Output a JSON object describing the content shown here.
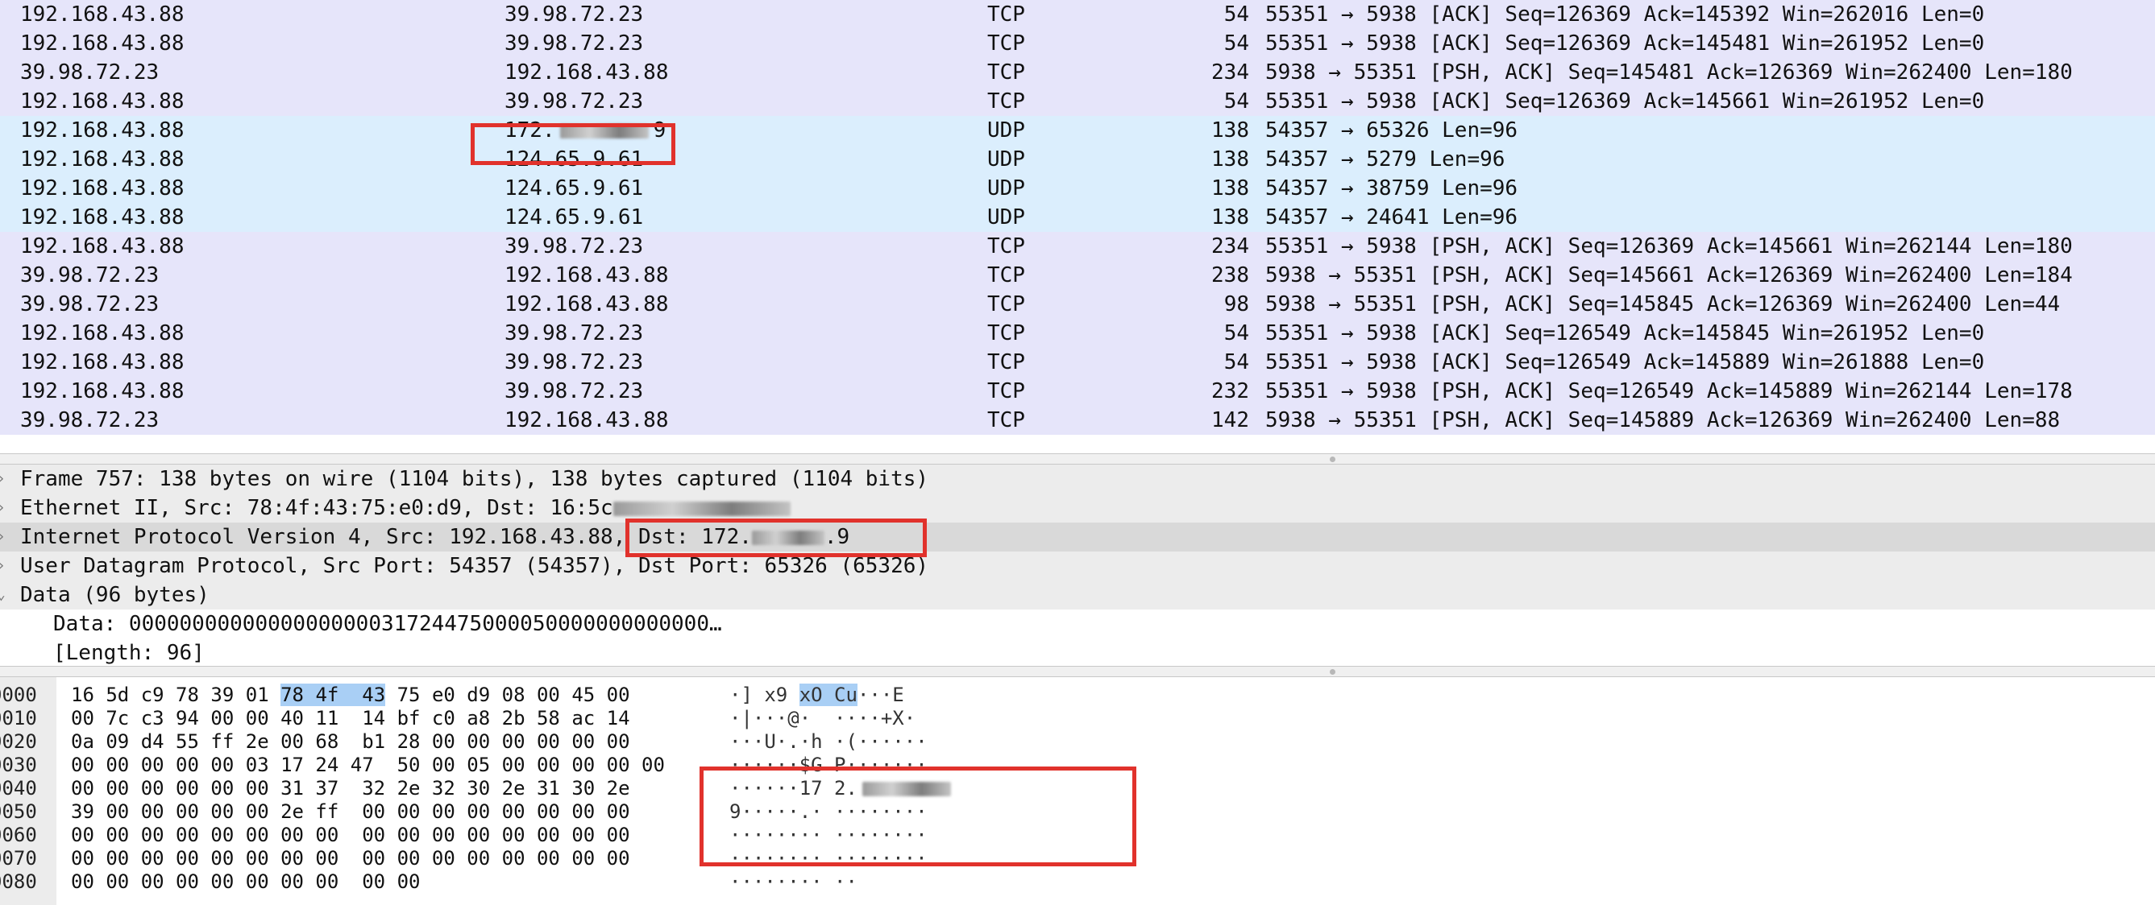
{
  "packets": [
    {
      "src": "192.168.43.88",
      "dst": "39.98.72.23",
      "proto": "TCP",
      "len": "54",
      "info": "55351 → 5938 [ACK] Seq=126369 Ack=145392 Win=262016 Len=0",
      "kind": "tcp"
    },
    {
      "src": "192.168.43.88",
      "dst": "39.98.72.23",
      "proto": "TCP",
      "len": "54",
      "info": "55351 → 5938 [ACK] Seq=126369 Ack=145481 Win=261952 Len=0",
      "kind": "tcp"
    },
    {
      "src": "39.98.72.23",
      "dst": "192.168.43.88",
      "proto": "TCP",
      "len": "234",
      "info": "5938 → 55351 [PSH, ACK] Seq=145481 Ack=126369 Win=262400 Len=180",
      "kind": "tcp"
    },
    {
      "src": "192.168.43.88",
      "dst": "39.98.72.23",
      "proto": "TCP",
      "len": "54",
      "info": "55351 → 5938 [ACK] Seq=126369 Ack=145661 Win=261952 Len=0",
      "kind": "tcp"
    },
    {
      "src": "192.168.43.88",
      "dst": "172.",
      "dst_tail": "9",
      "proto": "UDP",
      "len": "138",
      "info": "54357 → 65326 Len=96",
      "kind": "udp"
    },
    {
      "src": "192.168.43.88",
      "dst": "124.65.9.61",
      "proto": "UDP",
      "len": "138",
      "info": "54357 → 5279 Len=96",
      "kind": "udp"
    },
    {
      "src": "192.168.43.88",
      "dst": "124.65.9.61",
      "proto": "UDP",
      "len": "138",
      "info": "54357 → 38759 Len=96",
      "kind": "udp"
    },
    {
      "src": "192.168.43.88",
      "dst": "124.65.9.61",
      "proto": "UDP",
      "len": "138",
      "info": "54357 → 24641 Len=96",
      "kind": "udp"
    },
    {
      "src": "192.168.43.88",
      "dst": "39.98.72.23",
      "proto": "TCP",
      "len": "234",
      "info": "55351 → 5938 [PSH, ACK] Seq=126369 Ack=145661 Win=262144 Len=180",
      "kind": "tcp"
    },
    {
      "src": "39.98.72.23",
      "dst": "192.168.43.88",
      "proto": "TCP",
      "len": "238",
      "info": "5938 → 55351 [PSH, ACK] Seq=145661 Ack=126369 Win=262400 Len=184",
      "kind": "tcp"
    },
    {
      "src": "39.98.72.23",
      "dst": "192.168.43.88",
      "proto": "TCP",
      "len": "98",
      "info": "5938 → 55351 [PSH, ACK] Seq=145845 Ack=126369 Win=262400 Len=44",
      "kind": "tcp"
    },
    {
      "src": "192.168.43.88",
      "dst": "39.98.72.23",
      "proto": "TCP",
      "len": "54",
      "info": "55351 → 5938 [ACK] Seq=126549 Ack=145845 Win=261952 Len=0",
      "kind": "tcp"
    },
    {
      "src": "192.168.43.88",
      "dst": "39.98.72.23",
      "proto": "TCP",
      "len": "54",
      "info": "55351 → 5938 [ACK] Seq=126549 Ack=145889 Win=261888 Len=0",
      "kind": "tcp"
    },
    {
      "src": "192.168.43.88",
      "dst": "39.98.72.23",
      "proto": "TCP",
      "len": "232",
      "info": "55351 → 5938 [PSH, ACK] Seq=126549 Ack=145889 Win=262144 Len=178",
      "kind": "tcp"
    },
    {
      "src": "39.98.72.23",
      "dst": "192.168.43.88",
      "proto": "TCP",
      "len": "142",
      "info": "5938 → 55351 [PSH, ACK] Seq=145889 Ack=126369 Win=262400 Len=88",
      "kind": "tcp"
    }
  ],
  "details": {
    "frame": "Frame 757: 138 bytes on wire (1104 bits), 138 bytes captured (1104 bits)",
    "ethernet": "Ethernet II, Src: 78:4f:43:75:e0:d9, Dst: 16:5c",
    "ip_prefix": "Internet Protocol Version 4, Src: 192.168.43.88, ",
    "ip_dst": "Dst: 172.",
    "ip_dst_tail": ".9",
    "udp": "User Datagram Protocol, Src Port: 54357 (54357), Dst Port: 65326 (65326)",
    "data": "Data (96 bytes)",
    "data_value": "Data: 0000000000000000000031724475000050000000000000…",
    "data_length": "[Length: 96]"
  },
  "hex": [
    {
      "off": "0000",
      "pre": "16 5d c9 78 39 01 ",
      "hl": "78 4f  43",
      "post": " 75 e0 d9 08 00 45 00",
      "asc_pre": "·] x9 ",
      "asc_hl": "xO Cu",
      "asc_post": "···E"
    },
    {
      "off": "0010",
      "pre": "00 7c c3 94 00 00 40 11  14 bf c0 a8 2b 58 ac 14",
      "asc_pre": "·|···@·  ····+X·"
    },
    {
      "off": "0020",
      "pre": "0a 09 d4 55 ff 2e 00 68  b1 28 00 00 00 00 00 00",
      "asc_pre": "···U·.·h ·(······"
    },
    {
      "off": "0030",
      "pre": "00 00 00 00 00 03 17 24 47  50 00 05 00 00 00 00 00",
      "asc_pre": "······$G P·······"
    },
    {
      "off": "0040",
      "pre": "00 00 00 00 00 00 31 37  32 2e 32 30 2e 31 30 2e",
      "asc_pre": "······17 2."
    },
    {
      "off": "0050",
      "pre": "39 00 00 00 00 00 2e ff  00 00 00 00 00 00 00 00",
      "asc_pre": "9·····.· ········"
    },
    {
      "off": "0060",
      "pre": "00 00 00 00 00 00 00 00  00 00 00 00 00 00 00 00",
      "asc_pre": "········ ········"
    },
    {
      "off": "0070",
      "pre": "00 00 00 00 00 00 00 00  00 00 00 00 00 00 00 00",
      "asc_pre": "········ ········"
    },
    {
      "off": "0080",
      "pre": "00 00 00 00 00 00 00 00  00 00",
      "asc_pre": "········ ··"
    }
  ],
  "colors": {
    "tcp_row": "#e6e5fa",
    "udp_row": "#dbeefd",
    "annotation": "#e1322c",
    "hex_highlight": "#a9cff5"
  }
}
